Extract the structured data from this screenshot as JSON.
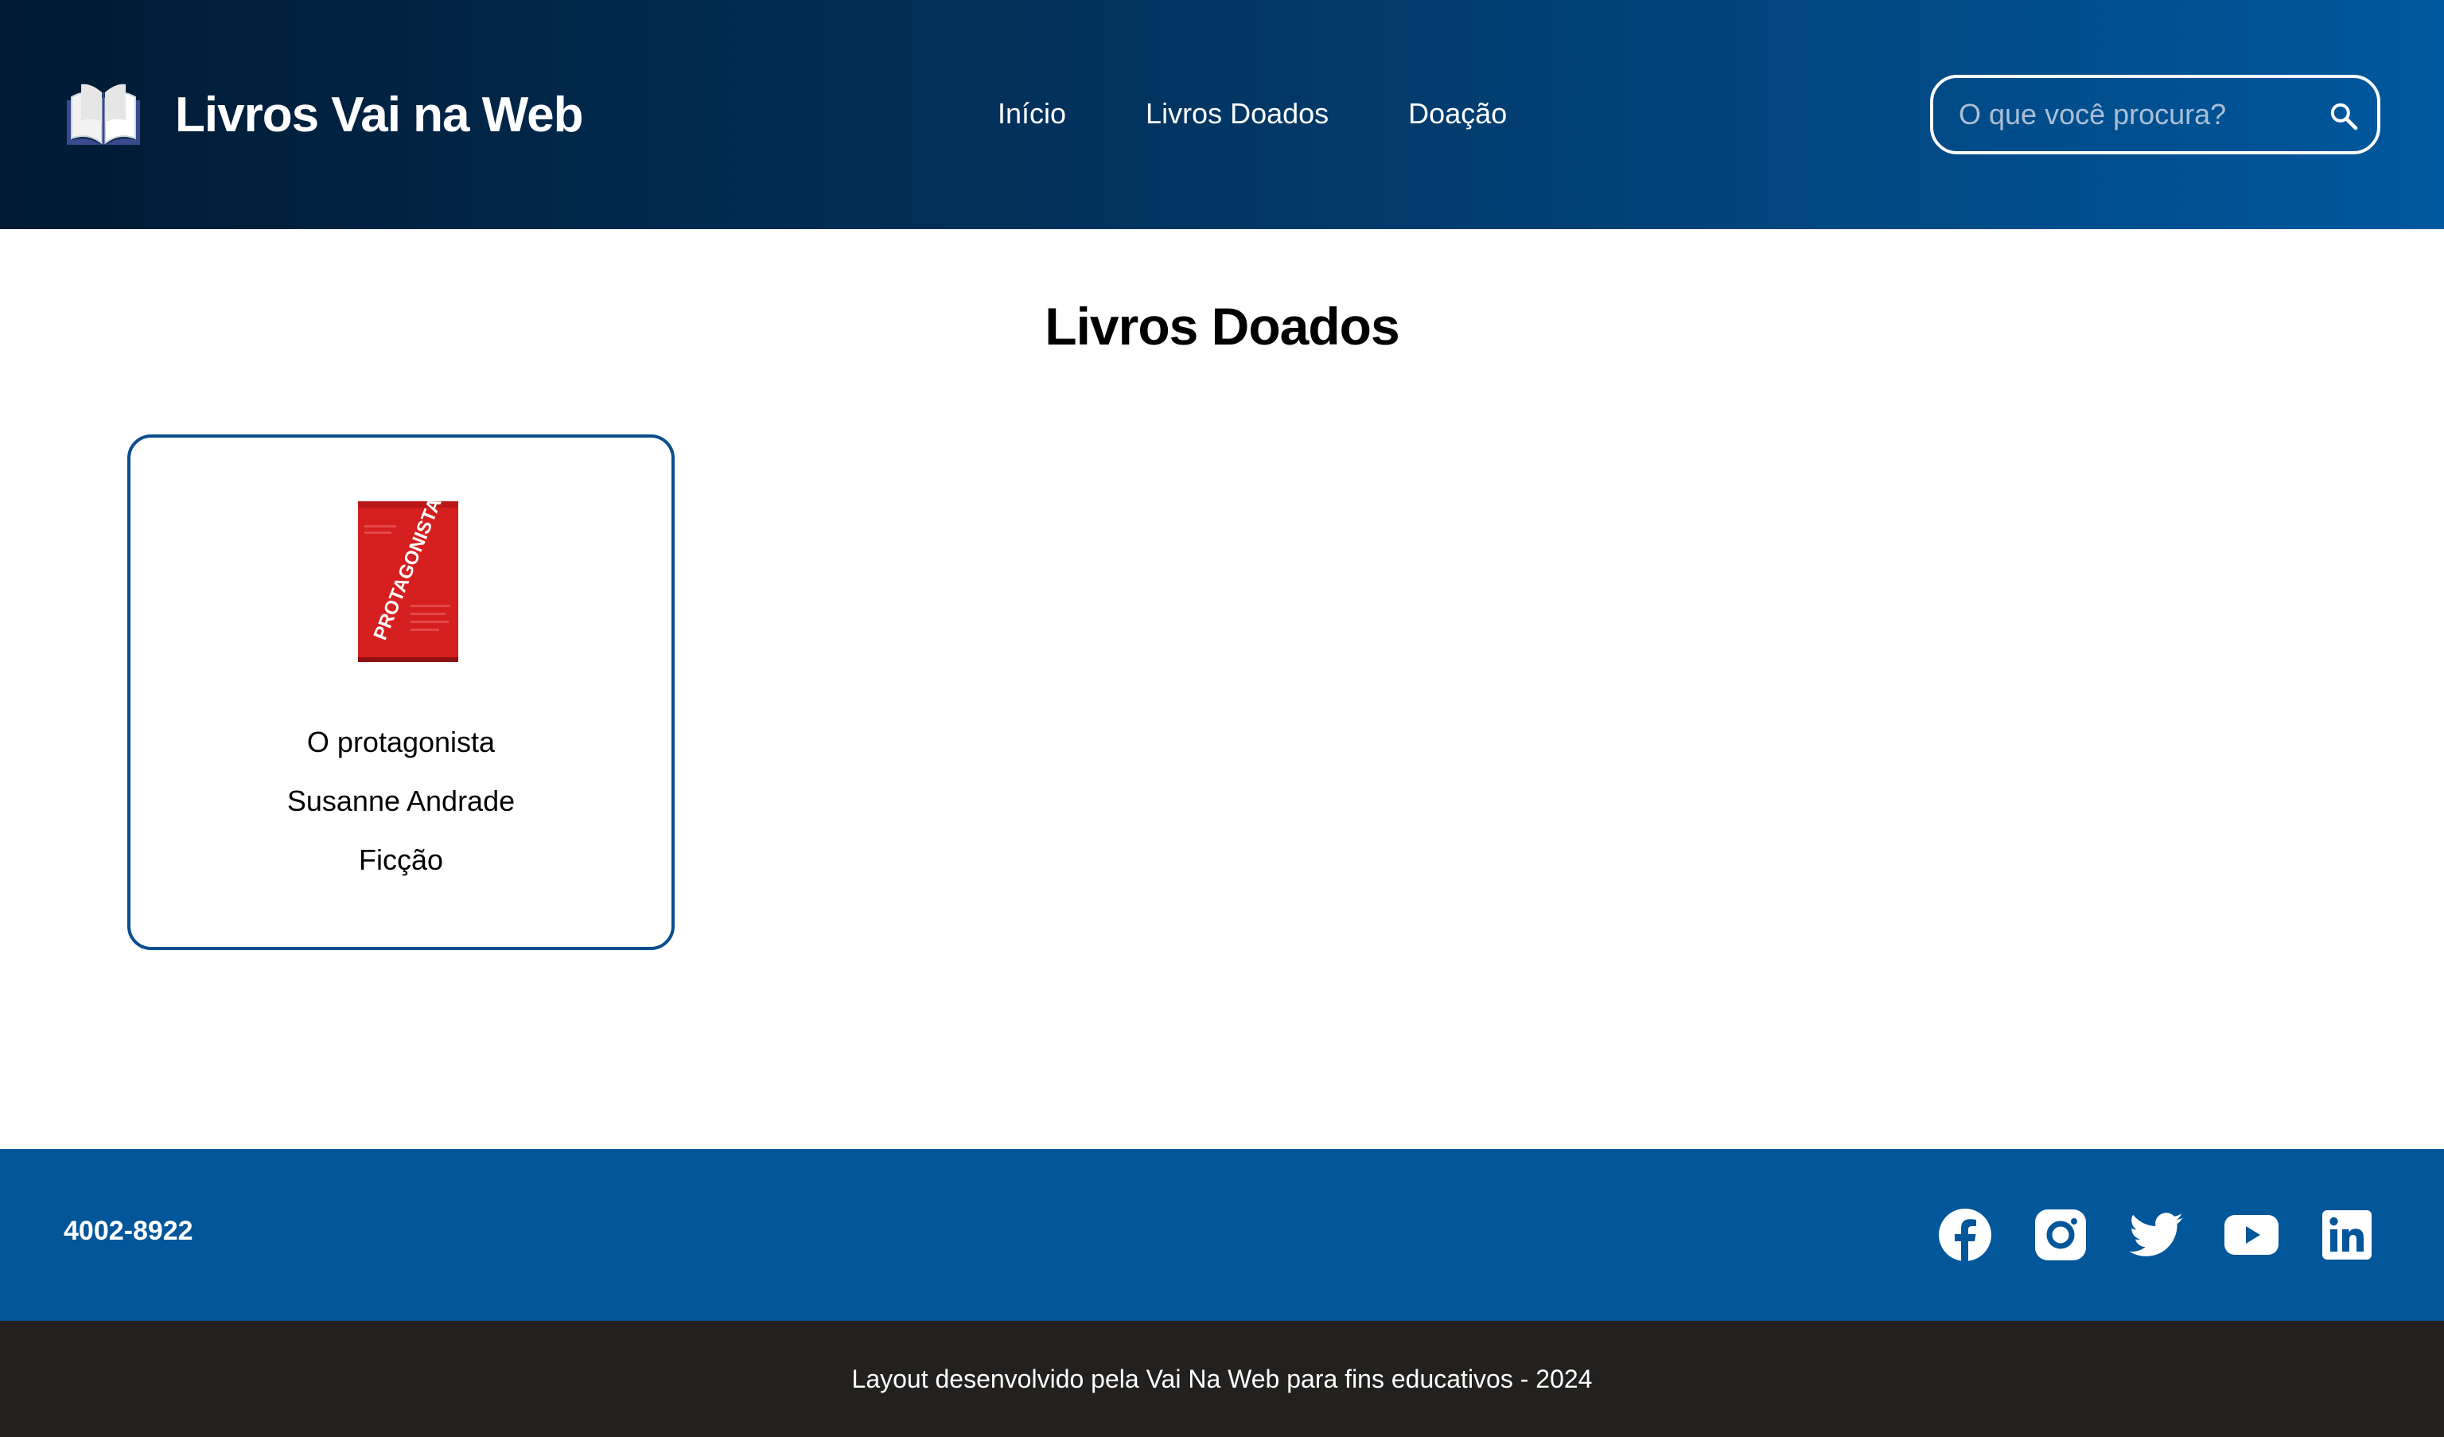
{
  "header": {
    "logo_icon": "open-book-icon",
    "title": "Livros Vai na Web",
    "nav": [
      {
        "label": "Início"
      },
      {
        "label": "Livros Doados"
      },
      {
        "label": "Doação"
      }
    ],
    "search": {
      "placeholder": "O que você procura?",
      "icon": "search-icon"
    }
  },
  "main": {
    "page_title": "Livros Doados",
    "books": [
      {
        "cover_text": "PROTAGONISTA",
        "title": "O protagonista",
        "author": "Susanne Andrade",
        "category": "Ficção"
      }
    ]
  },
  "footer": {
    "phone": "4002-8922",
    "socials": [
      "facebook-icon",
      "instagram-icon",
      "twitter-icon",
      "youtube-icon",
      "linkedin-icon"
    ],
    "copyright": "Layout desenvolvido pela Vai Na Web para fins educativos - 2024"
  },
  "colors": {
    "header_gradient_start": "#001a33",
    "header_gradient_end": "#00589e",
    "card_border": "#0a4e8f",
    "footer_blue": "#02569a",
    "copyright_bg": "#23211f",
    "cover_red": "#d61f1f"
  }
}
